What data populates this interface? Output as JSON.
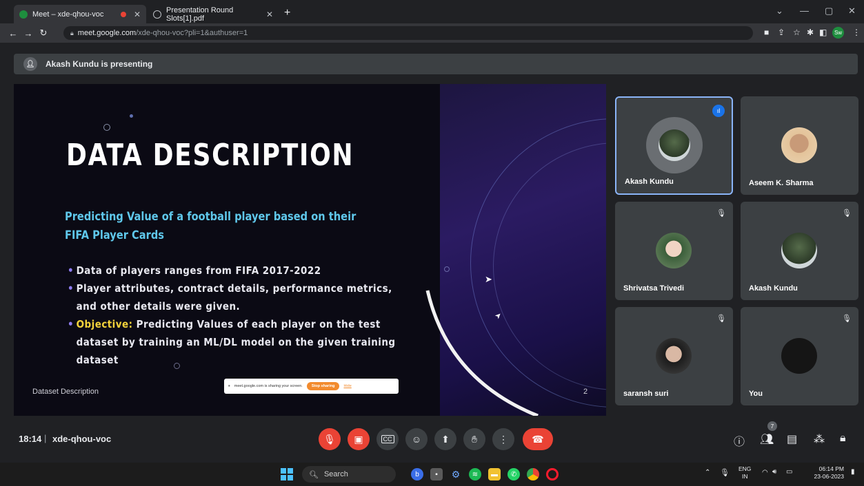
{
  "browser": {
    "tabs": [
      {
        "title": "Meet – xde-qhou-voc"
      },
      {
        "title": "Presentation Round Slots[1].pdf"
      }
    ],
    "url_host": "meet.google.com",
    "url_path": "/xde-qhou-voc?pli=1&authuser=1",
    "profile_initials": "Sw"
  },
  "presentation_banner": {
    "text": "Akash Kundu is presenting"
  },
  "slide": {
    "title": "DATA DESCRIPTION",
    "subtitle": "Predicting Value of a football player based on their FIFA Player Cards",
    "bullets": [
      {
        "text": "Data of players ranges from FIFA 2017-2022"
      },
      {
        "text": "Player attributes, contract details, performance metrics, and other details were given."
      },
      {
        "highlight": "Objective:",
        "text": " Predicting Values of each player on the test dataset by training an ML/DL model on the given training dataset"
      }
    ],
    "footer": "Dataset Description",
    "page_number": "2"
  },
  "share_notice": {
    "text": "meet.google.com is sharing your screen.",
    "stop_label": "Stop sharing",
    "hide_label": "Hide"
  },
  "participants": [
    {
      "name": "Akash Kundu",
      "speaking": true,
      "muted": false
    },
    {
      "name": "Aseem K. Sharma",
      "speaking": false,
      "muted": false
    },
    {
      "name": "Shrivatsa Trivedi",
      "speaking": false,
      "muted": true
    },
    {
      "name": "Akash Kundu",
      "speaking": false,
      "muted": true
    },
    {
      "name": "saransh suri",
      "speaking": false,
      "muted": true
    },
    {
      "name": "You",
      "speaking": false,
      "muted": true
    }
  ],
  "meeting": {
    "time": "18:14",
    "separator": "|",
    "code": "xde-qhou-voc",
    "participant_count": "7"
  },
  "taskbar": {
    "search_placeholder": "Search",
    "lang_line1": "ENG",
    "lang_line2": "IN",
    "time": "06:14 PM",
    "date": "23-06-2023"
  },
  "colors": {
    "meet_bg": "#202124",
    "tile_bg": "#3c4043",
    "mute_red": "#ea4335",
    "speaking_border": "#8ab4f8",
    "slide_title": "#ffffff",
    "slide_subtitle": "#5fc7ea",
    "objective_highlight": "#f4d33b"
  }
}
